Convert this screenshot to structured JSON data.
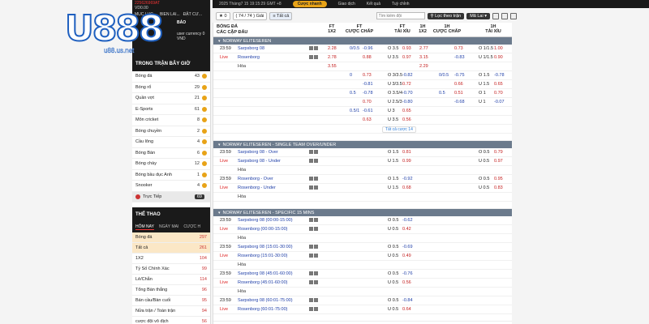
{
  "brand": {
    "logo_text": "U888",
    "logo_sub": "u88.us.net"
  },
  "topbar": {
    "date": "2025 Tháng7 15 19:15:29 GMT +8",
    "bet_button": "Cược nhanh",
    "links": [
      "Giao dịch",
      "Kết quả",
      "Tuỳ chỉnh"
    ]
  },
  "sidebar": {
    "account": "225626969AT",
    "balance": "VD0.00",
    "top_tabs": [
      "MUC LUC...",
      "BIEN LAI...",
      "ĐẶT CƯ..."
    ],
    "header_label": "BÁO",
    "welcome": "user currency 0 VND",
    "in_play_header": "TRONG TRẬN BÂY GIỜ",
    "in_play": [
      {
        "label": "Bóng đá",
        "count": "43"
      },
      {
        "label": "Bóng rổ",
        "count": "29"
      },
      {
        "label": "Quần vợt",
        "count": "21"
      },
      {
        "label": "E-Sports",
        "count": "61"
      },
      {
        "label": "Môn cricket",
        "count": "8"
      },
      {
        "label": "Bóng chuyền",
        "count": "2"
      },
      {
        "label": "Cầu lông",
        "count": "4"
      },
      {
        "label": "Bóng Bàn",
        "count": "6"
      },
      {
        "label": "Bóng chày",
        "count": "12"
      },
      {
        "label": "Bóng bầu dục Anh",
        "count": "1"
      },
      {
        "label": "Snooker",
        "count": "4"
      }
    ],
    "live_item": {
      "label": "Trực Tiếp",
      "count": "69"
    },
    "sports_header": "THỂ THAO",
    "sports_tabs": [
      "HÔM NAY",
      "NGÀY MAI",
      "CƯỢC H"
    ],
    "sports": [
      {
        "label": "Bóng đá",
        "count": "297",
        "hl": true
      },
      {
        "label": "Tất cả",
        "count": "261",
        "hl": true
      },
      {
        "label": "1X2",
        "count": "104",
        "hl": false
      },
      {
        "label": "Tỷ Số Chính Xác",
        "count": "99",
        "hl": false
      },
      {
        "label": "Lẻ/Chẵn",
        "count": "114",
        "hl": false
      },
      {
        "label": "Tổng Bàn thắng",
        "count": "96",
        "hl": false
      },
      {
        "label": "Bán cầu/Bàn cuối",
        "count": "95",
        "hl": false
      },
      {
        "label": "Nửa trận / Toàn trận",
        "count": "94",
        "hl": false
      },
      {
        "label": "cược đội vô địch",
        "count": "56",
        "hl": false
      },
      {
        "label": "Bóng rổ",
        "count": "239",
        "hl": false
      }
    ]
  },
  "toolbar": {
    "star_count": "0",
    "match_count": "74 / 74",
    "period": "Giải",
    "all_label": "Tất cả",
    "search_placeholder": "Tìm kiếm đội",
    "filter_label": "Lọc theo trận",
    "refresh_label": "Mã Lai"
  },
  "table": {
    "headers": {
      "col1": "BÓNG ĐÁ",
      "col1b": "CÁC CẶP ĐẤU",
      "ft1x2": "FT\n1X2",
      "ftcuoc": "FT\nCƯỢC CHẤP",
      "fttx": "FT\nTÀI XỈU",
      "h1x2": "1H\n1X2",
      "hcuoc": "1H\nCƯỢC CHẤP",
      "htx": "1H\nTÀI XỈU"
    },
    "sections": [
      {
        "league": "NORWAY ELITESEREN",
        "rows": [
          {
            "time": "23:59",
            "team": "Sarpsborg 08",
            "ft1x2": "2.28",
            "hc_line": "0/0.5",
            "hc_odd": "-0.96",
            "ou_line": "O 3.5",
            "ou_odd": "0.93",
            "h1x2": "2.77",
            "h_hc": "0.73",
            "h_ou": "O 1/1.5",
            "h_ou_odd": "1.00",
            "icons": true
          },
          {
            "time": "Live",
            "team": "Rosenborg",
            "ft1x2": "2.78",
            "hc_line": "",
            "hc_odd": "0.88",
            "ou_line": "U 3.5",
            "ou_odd": "0.97",
            "h1x2": "3.15",
            "h_hc": "-0.83",
            "h_ou": "U 1/1.5",
            "h_ou_odd": "0.90",
            "icons": true
          },
          {
            "time": "",
            "team": "Hòa",
            "ft1x2": "3.55",
            "hc_line": "",
            "hc_odd": "",
            "ou_line": "",
            "ou_odd": "",
            "h1x2": "2.29",
            "h_hc": "",
            "h_ou": "",
            "h_ou_odd": "",
            "icons": false,
            "draw": true
          },
          {
            "time": "",
            "team": "",
            "ft1x2": "",
            "hc_line": "0",
            "hc_odd": "0.73",
            "ou_line": "O 3/3.5",
            "ou_odd": "-0.82",
            "h1x2": "",
            "h_hc_line": "0/0.5",
            "h_hc": "-0.75",
            "h_ou": "O 1.5",
            "h_ou_odd": "-0.78"
          },
          {
            "time": "",
            "team": "",
            "ft1x2": "",
            "hc_line": "",
            "hc_odd": "-0.81",
            "ou_line": "U 3/3.5",
            "ou_odd": "0.72",
            "h1x2": "",
            "h_hc_line": "",
            "h_hc": "0.66",
            "h_ou": "U 1.5",
            "h_ou_odd": "0.65"
          },
          {
            "time": "",
            "team": "",
            "ft1x2": "",
            "hc_line": "0.5",
            "hc_odd": "-0.78",
            "ou_line": "O 3.5/4",
            "ou_odd": "-0.70",
            "h1x2": "",
            "h_hc_line": "0.5",
            "h_hc": "0.51",
            "h_ou": "O 1",
            "h_ou_odd": "0.70"
          },
          {
            "time": "",
            "team": "",
            "ft1x2": "",
            "hc_line": "",
            "hc_odd": "0.70",
            "ou_line": "U 2.5/3",
            "ou_odd": "-0.80",
            "h1x2": "",
            "h_hc_line": "",
            "h_hc": "-0.68",
            "h_ou": "U 1",
            "h_ou_odd": "-0.07"
          },
          {
            "time": "",
            "team": "",
            "ft1x2": "",
            "hc_line": "0.5/1",
            "hc_odd": "-0.61",
            "ou_line": "U 3",
            "ou_odd": "0.65"
          },
          {
            "time": "",
            "team": "",
            "ft1x2": "",
            "hc_line": "",
            "hc_odd": "0.63",
            "ou_line": "U 3.5",
            "ou_odd": "0.56"
          }
        ],
        "more": "Tất cả cược 14"
      },
      {
        "league": "NORWAY ELITESEREN - SINGLE TEAM OVER/UNDER",
        "rows": [
          {
            "time": "23:59",
            "team": "Sarpsborg 08 - Over",
            "ou_line": "O 1.5",
            "ou_odd": "0.81",
            "h_ou": "O 0.5",
            "h_ou_odd": "0.79",
            "icons": true
          },
          {
            "time": "Live",
            "team": "Sarpsborg 08 - Under",
            "ou_line": "U 1.5",
            "ou_odd": "0.99",
            "h_ou": "U 0.5",
            "h_ou_odd": "0.97",
            "icons": true
          },
          {
            "time": "",
            "team": "Hòa",
            "draw": true
          },
          {
            "time": "23:59",
            "team": "Rosenborg - Over",
            "ou_line": "O 1.5",
            "ou_odd": "-0.92",
            "h_ou": "O 0.5",
            "h_ou_odd": "0.95",
            "icons": true
          },
          {
            "time": "Live",
            "team": "Rosenborg - Under",
            "ou_line": "U 1.5",
            "ou_odd": "0.68",
            "h_ou": "U 0.5",
            "h_ou_odd": "0.83",
            "icons": true
          },
          {
            "time": "",
            "team": "Hòa",
            "draw": true
          }
        ]
      },
      {
        "league": "NORWAY ELITESEREN - SPECIFIC 15 MINS",
        "rows": [
          {
            "time": "23:59",
            "team": "Sarpsborg 08 (00:00-15:00)",
            "ou_line": "O 0.5",
            "ou_odd": "-0.62",
            "icons": true
          },
          {
            "time": "Live",
            "team": "Rosenborg (00:00-15:00)",
            "ou_line": "U 0.5",
            "ou_odd": "0.42",
            "icons": true
          },
          {
            "time": "",
            "team": "Hòa",
            "draw": true
          },
          {
            "time": "23:59",
            "team": "Sarpsborg 08 (15:01-30:00)",
            "ou_line": "O 0.5",
            "ou_odd": "-0.69",
            "icons": true
          },
          {
            "time": "Live",
            "team": "Rosenborg (15:01-30:00)",
            "ou_line": "U 0.5",
            "ou_odd": "0.49",
            "icons": true
          },
          {
            "time": "",
            "team": "Hòa",
            "draw": true
          },
          {
            "time": "23:59",
            "team": "Sarpsborg 08 (45:01-60:00)",
            "ou_line": "O 0.5",
            "ou_odd": "-0.76",
            "icons": true
          },
          {
            "time": "Live",
            "team": "Rosenborg (45:01-60:00)",
            "ou_line": "U 0.5",
            "ou_odd": "0.56",
            "icons": true
          },
          {
            "time": "",
            "team": "Hòa",
            "draw": true
          },
          {
            "time": "23:59",
            "team": "Sarpsborg 08 (60:01-75:00)",
            "ou_line": "O 0.5",
            "ou_odd": "-0.84",
            "icons": true
          },
          {
            "time": "Live",
            "team": "Rosenborg (60:01-75:00)",
            "ou_line": "U 0.5",
            "ou_odd": "0.64",
            "icons": true
          }
        ]
      }
    ]
  }
}
